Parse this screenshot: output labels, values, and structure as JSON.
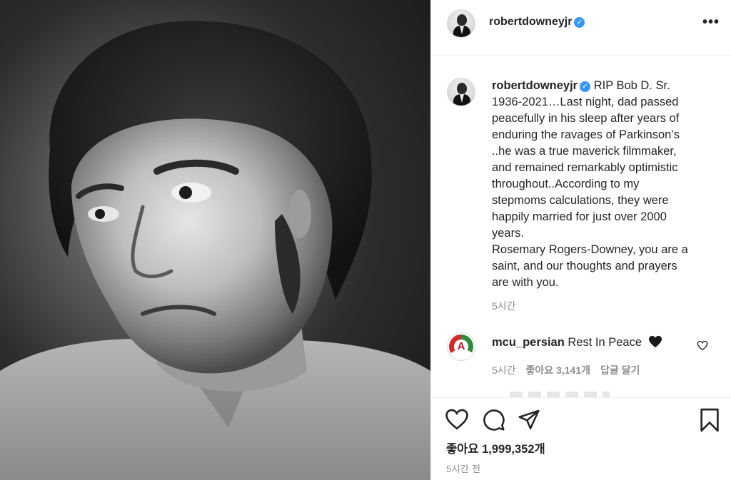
{
  "post": {
    "username": "robertdowneyjr",
    "verified_glyph": "✓",
    "more_label": "•••",
    "caption_lines": [
      "RIP Bob D. Sr.",
      "1936-2021…Last night, dad passed",
      "peacefully in his sleep after years of",
      "enduring the ravages of Parkinson’s",
      "..he was a true maverick filmmaker,",
      "and remained remarkably optimistic",
      "throughout..According to my",
      "stepmoms calculations, they were",
      "happily married for just over 2000",
      "years.",
      "Rosemary Rogers-Downey, you are a",
      "saint, and our thoughts and prayers",
      "are with you."
    ],
    "caption_time": "5시간",
    "likes": "좋아요 1,999,352개",
    "time_ago": "5시간 전"
  },
  "comment": {
    "username": "mcu_persian",
    "text": "Rest In Peace",
    "avatar_letter": "A",
    "time": "5시간",
    "likes": "좋아요 3,141개",
    "reply": "답글 달기"
  },
  "icons": {
    "header_avatar": "avatar-icon",
    "verified": "verified-badge-icon",
    "more": "more-options-icon",
    "comment_heart": "heart-outline-icon",
    "black_heart": "black-heart-emoji-icon",
    "like": "heart-outline-icon",
    "comment": "comment-bubble-icon",
    "share": "paper-plane-icon",
    "save": "bookmark-icon"
  },
  "colors": {
    "verified": "#3897f0",
    "secondary_text": "#8e8e8e",
    "primary_text": "#262626",
    "divider": "#efefef"
  }
}
